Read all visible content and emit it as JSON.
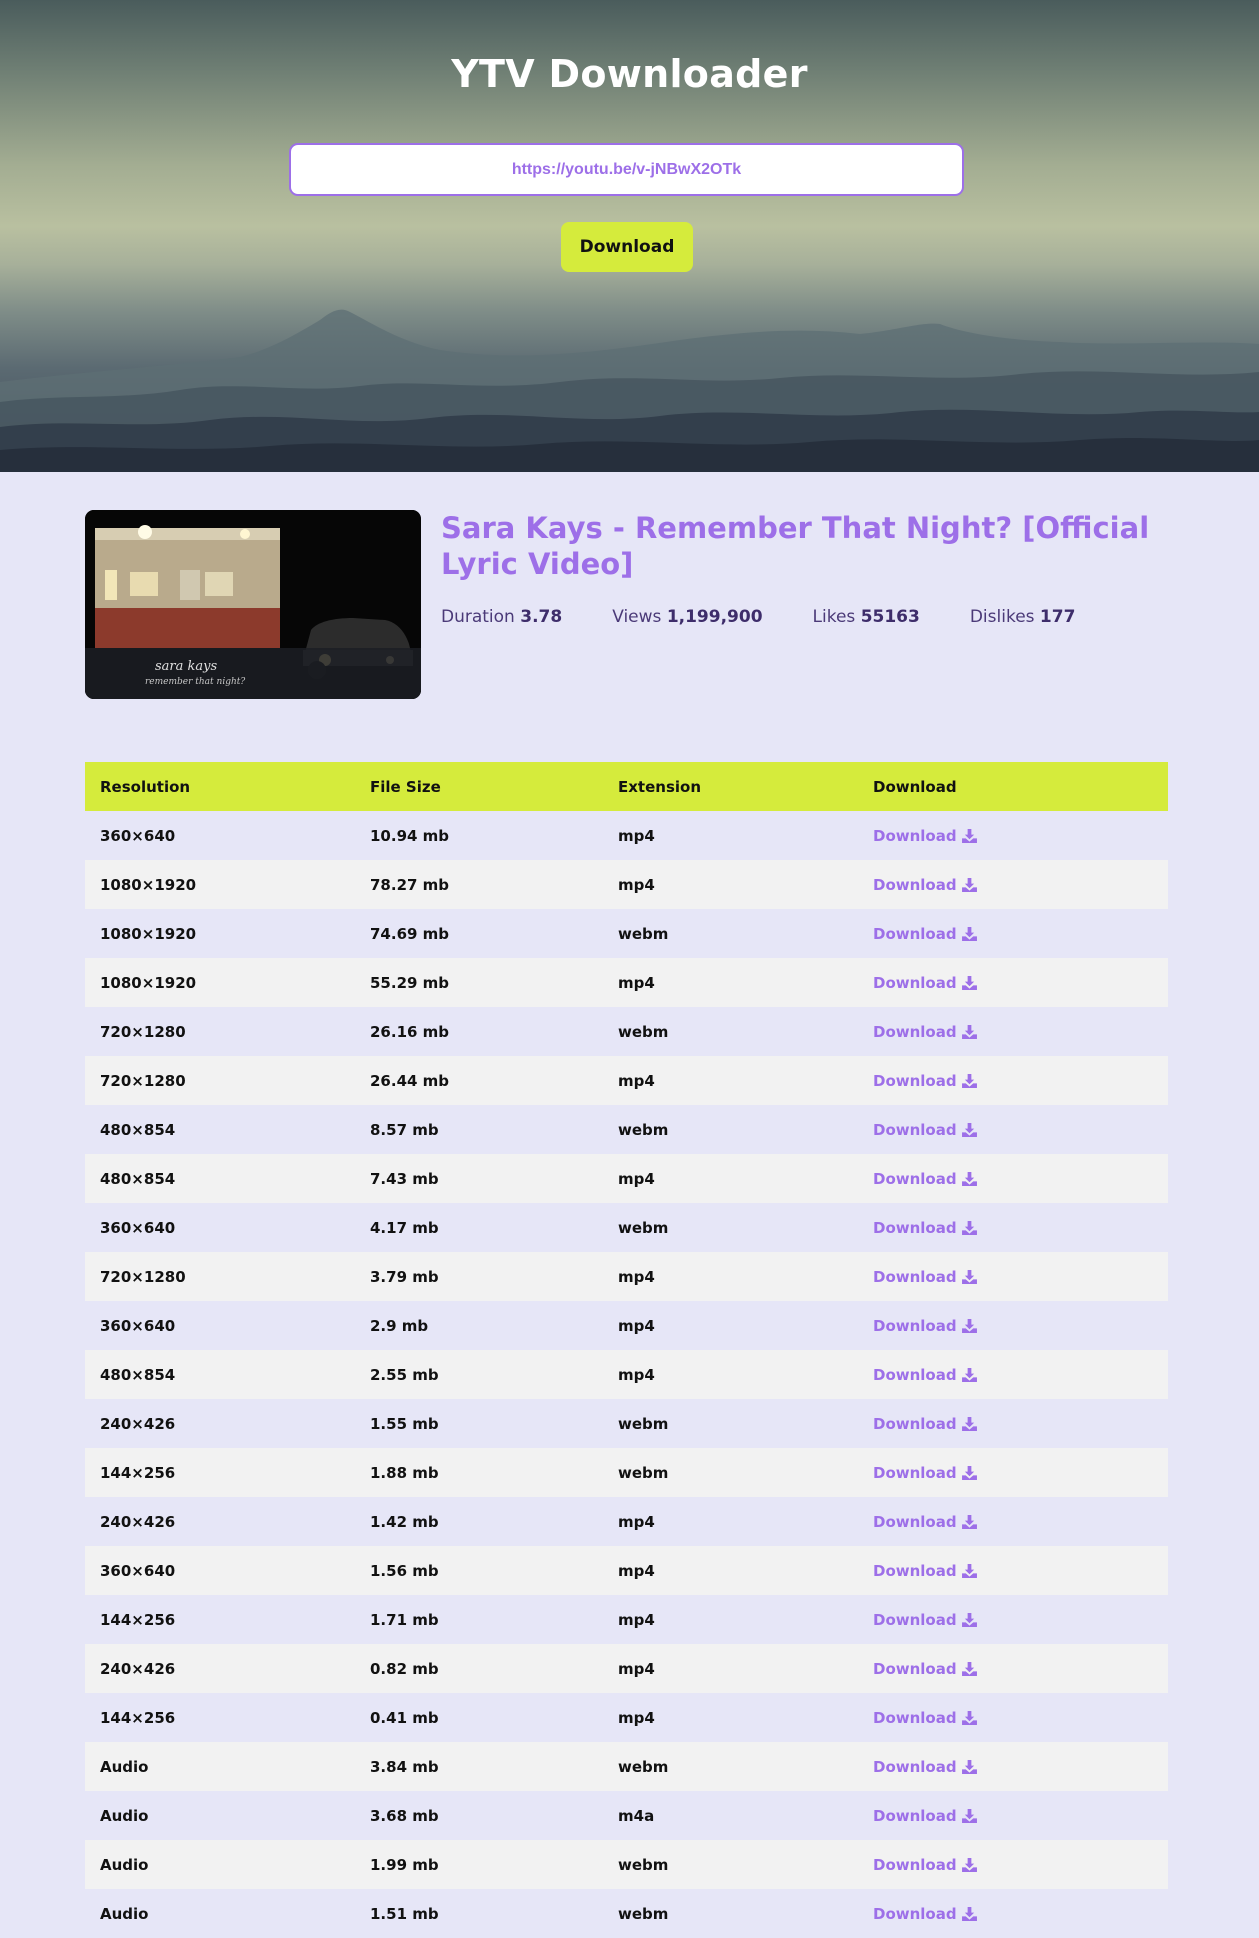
{
  "app": {
    "title": "YTV Downloader"
  },
  "search": {
    "value": "https://youtu.be/v-jNBwX2OTk",
    "placeholder": "",
    "button_label": "Download"
  },
  "video": {
    "title": "Sara Kays - Remember That Night? [Official Lyric Video]",
    "thumbnail_caption_line1": "sara kays",
    "thumbnail_caption_line2": "remember that night?",
    "stats": {
      "duration_label": "Duration",
      "duration_value": "3.78",
      "views_label": "Views",
      "views_value": "1,199,900",
      "likes_label": "Likes",
      "likes_value": "55163",
      "dislikes_label": "Dislikes",
      "dislikes_value": "177"
    }
  },
  "table": {
    "headers": {
      "resolution": "Resolution",
      "file_size": "File Size",
      "extension": "Extension",
      "download": "Download"
    },
    "link_label": "Download",
    "rows": [
      {
        "resolution": "360×640",
        "size": "10.94 mb",
        "ext": "mp4"
      },
      {
        "resolution": "1080×1920",
        "size": "78.27 mb",
        "ext": "mp4"
      },
      {
        "resolution": "1080×1920",
        "size": "74.69 mb",
        "ext": "webm"
      },
      {
        "resolution": "1080×1920",
        "size": "55.29 mb",
        "ext": "mp4"
      },
      {
        "resolution": "720×1280",
        "size": "26.16 mb",
        "ext": "webm"
      },
      {
        "resolution": "720×1280",
        "size": "26.44 mb",
        "ext": "mp4"
      },
      {
        "resolution": "480×854",
        "size": "8.57 mb",
        "ext": "webm"
      },
      {
        "resolution": "480×854",
        "size": "7.43 mb",
        "ext": "mp4"
      },
      {
        "resolution": "360×640",
        "size": "4.17 mb",
        "ext": "webm"
      },
      {
        "resolution": "720×1280",
        "size": "3.79 mb",
        "ext": "mp4"
      },
      {
        "resolution": "360×640",
        "size": "2.9 mb",
        "ext": "mp4"
      },
      {
        "resolution": "480×854",
        "size": "2.55 mb",
        "ext": "mp4"
      },
      {
        "resolution": "240×426",
        "size": "1.55 mb",
        "ext": "webm"
      },
      {
        "resolution": "144×256",
        "size": "1.88 mb",
        "ext": "webm"
      },
      {
        "resolution": "240×426",
        "size": "1.42 mb",
        "ext": "mp4"
      },
      {
        "resolution": "360×640",
        "size": "1.56 mb",
        "ext": "mp4"
      },
      {
        "resolution": "144×256",
        "size": "1.71 mb",
        "ext": "mp4"
      },
      {
        "resolution": "240×426",
        "size": "0.82 mb",
        "ext": "mp4"
      },
      {
        "resolution": "144×256",
        "size": "0.41 mb",
        "ext": "mp4"
      },
      {
        "resolution": "Audio",
        "size": "3.84 mb",
        "ext": "webm"
      },
      {
        "resolution": "Audio",
        "size": "3.68 mb",
        "ext": "m4a"
      },
      {
        "resolution": "Audio",
        "size": "1.99 mb",
        "ext": "webm"
      },
      {
        "resolution": "Audio",
        "size": "1.51 mb",
        "ext": "webm"
      }
    ]
  },
  "colors": {
    "accent_purple": "#9d6fe8",
    "accent_lime": "#d5eb3c",
    "page_background": "#e6e6f7",
    "row_alt": "#f2f2f2"
  },
  "icons": {
    "download": "download-arrow-icon"
  }
}
